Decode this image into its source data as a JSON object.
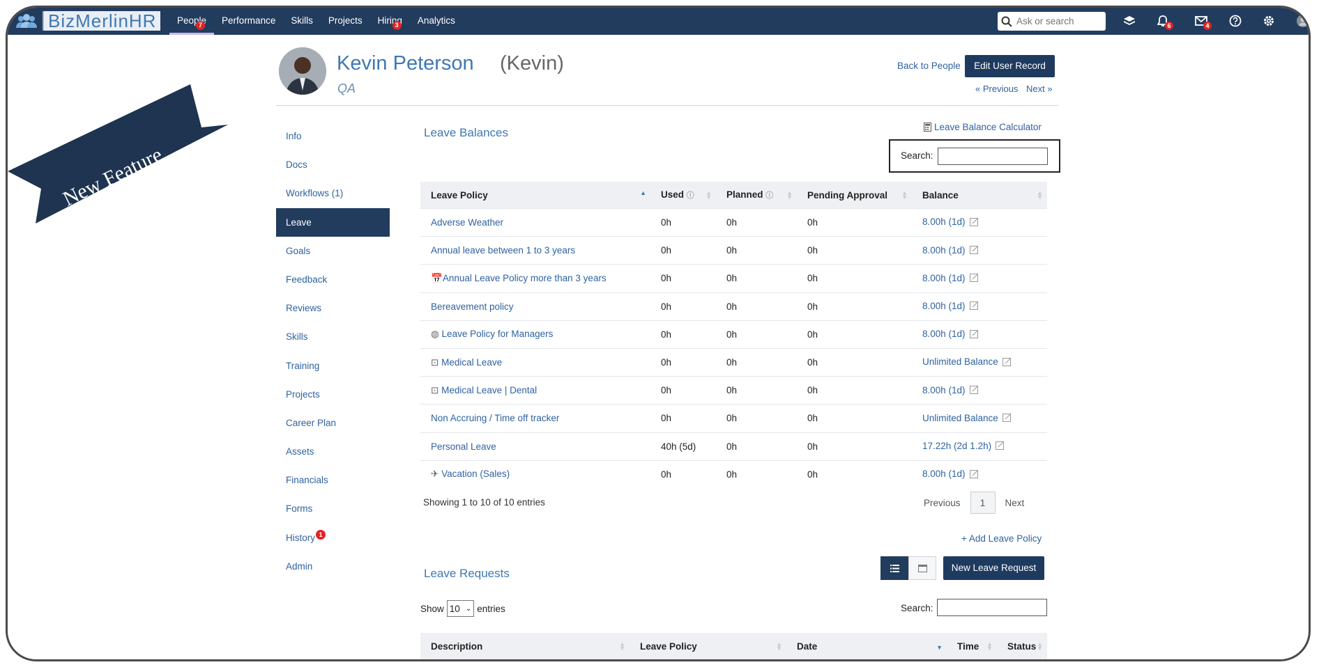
{
  "app": {
    "brand": "BizMerlinHR",
    "nav": [
      {
        "label": "People",
        "badge": "7",
        "active": true
      },
      {
        "label": "Performance",
        "badge": ""
      },
      {
        "label": "Skills",
        "badge": ""
      },
      {
        "label": "Projects",
        "badge": ""
      },
      {
        "label": "Hiring",
        "badge": "3"
      },
      {
        "label": "Analytics",
        "badge": ""
      }
    ],
    "search_placeholder": "Ask or search",
    "notifications_badge": "6",
    "messages_badge": "4"
  },
  "ribbon": {
    "text": "New Feature"
  },
  "profile": {
    "name": "Kevin Peterson",
    "nickname": "(Kevin)",
    "role": "QA",
    "back_link": "Back to People",
    "edit_button": "Edit User Record",
    "prev_link": "« Previous",
    "next_link": "Next »"
  },
  "sidenav": [
    {
      "label": "Info"
    },
    {
      "label": "Docs"
    },
    {
      "label": "Workflows (1)"
    },
    {
      "label": "Leave",
      "active": true
    },
    {
      "label": "Goals"
    },
    {
      "label": "Feedback"
    },
    {
      "label": "Reviews"
    },
    {
      "label": "Skills"
    },
    {
      "label": "Training"
    },
    {
      "label": "Projects"
    },
    {
      "label": "Career Plan"
    },
    {
      "label": "Assets"
    },
    {
      "label": "Financials"
    },
    {
      "label": "Forms"
    },
    {
      "label": "History",
      "badge": "1"
    },
    {
      "label": "Admin"
    }
  ],
  "leave_balances": {
    "title": "Leave Balances",
    "calculator_link": "Leave Balance Calculator",
    "search_label": "Search:",
    "columns": [
      "Leave Policy",
      "Used",
      "Planned",
      "Pending Approval",
      "Balance"
    ],
    "rows": [
      {
        "policy": "Adverse Weather",
        "icon": "",
        "used": "0h",
        "planned": "0h",
        "pending": "0h",
        "balance": "8.00h (1d)"
      },
      {
        "policy": "Annual leave between 1 to 3 years",
        "icon": "",
        "used": "0h",
        "planned": "0h",
        "pending": "0h",
        "balance": "8.00h (1d)"
      },
      {
        "policy": "Annual Leave Policy more than 3 years",
        "icon": "calendar-icon",
        "used": "0h",
        "planned": "0h",
        "pending": "0h",
        "balance": "8.00h (1d)"
      },
      {
        "policy": "Bereavement policy",
        "icon": "",
        "used": "0h",
        "planned": "0h",
        "pending": "0h",
        "balance": "8.00h (1d)"
      },
      {
        "policy": "Leave Policy for Managers",
        "icon": "globe-icon",
        "used": "0h",
        "planned": "0h",
        "pending": "0h",
        "balance": "8.00h (1d)"
      },
      {
        "policy": "Medical Leave",
        "icon": "camera-icon",
        "used": "0h",
        "planned": "0h",
        "pending": "0h",
        "balance": "Unlimited Balance"
      },
      {
        "policy": "Medical Leave | Dental",
        "icon": "camera-icon",
        "used": "0h",
        "planned": "0h",
        "pending": "0h",
        "balance": "8.00h (1d)"
      },
      {
        "policy": "Non Accruing / Time off tracker",
        "icon": "",
        "used": "0h",
        "planned": "0h",
        "pending": "0h",
        "balance": "Unlimited Balance"
      },
      {
        "policy": "Personal Leave",
        "icon": "",
        "used": "40h (5d)",
        "planned": "0h",
        "pending": "0h",
        "balance": "17.22h (2d 1.2h)"
      },
      {
        "policy": "Vacation (Sales)",
        "icon": "plane-icon",
        "used": "0h",
        "planned": "0h",
        "pending": "0h",
        "balance": "8.00h (1d)"
      }
    ],
    "showing": "Showing 1 to 10 of 10 entries",
    "pager": {
      "previous": "Previous",
      "page": "1",
      "next": "Next"
    },
    "add_policy": "+ Add Leave Policy"
  },
  "leave_requests": {
    "title": "Leave Requests",
    "new_button": "New Leave Request",
    "show_label": "Show",
    "show_value": "10",
    "entries_label": "entries",
    "search_label": "Search:",
    "columns": [
      "Description",
      "Leave Policy",
      "Date",
      "Time",
      "Status"
    ]
  },
  "colors": {
    "nav_bg": "#223c5e",
    "link": "#2f62a0",
    "badge": "#e02424",
    "ribbon": "#1e3450"
  }
}
